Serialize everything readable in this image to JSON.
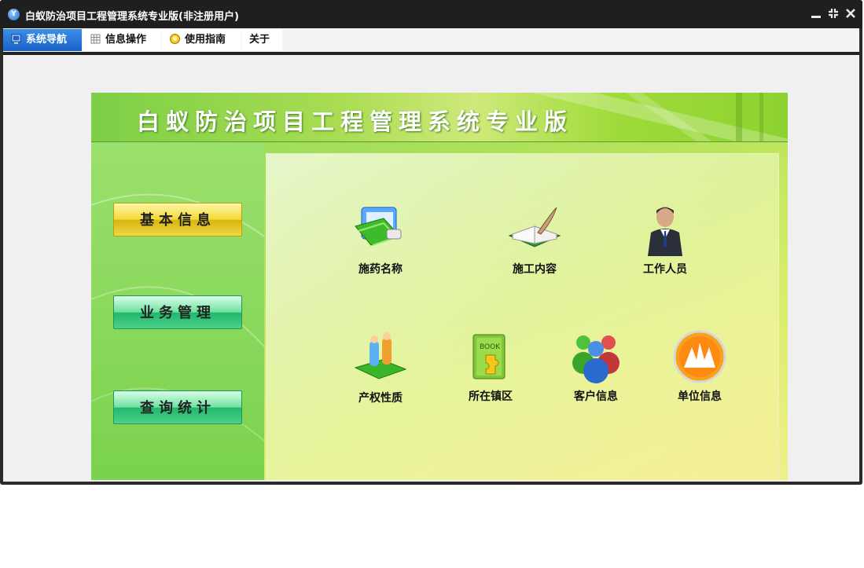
{
  "window": {
    "title": "白蚁防治项目工程管理系统专业版(非注册用户)"
  },
  "menu": {
    "tabs": [
      {
        "label": "系统导航"
      },
      {
        "label": "信息操作"
      },
      {
        "label": "使用指南"
      },
      {
        "label": "关于"
      }
    ]
  },
  "banner": {
    "title": "白蚁防治项目工程管理系统专业版"
  },
  "sidebar": {
    "buttons": [
      {
        "label": "基本信息"
      },
      {
        "label": "业务管理"
      },
      {
        "label": "查询统计"
      }
    ]
  },
  "modules": [
    {
      "label": "施药名称",
      "icon": "folder-doc-icon"
    },
    {
      "label": "施工内容",
      "icon": "book-quill-icon"
    },
    {
      "label": "工作人员",
      "icon": "businessman-icon"
    },
    {
      "label": "产权性质",
      "icon": "people-book-icon"
    },
    {
      "label": "所在镇区",
      "icon": "book-puzzle-icon"
    },
    {
      "label": "客户信息",
      "icon": "user-group-icon"
    },
    {
      "label": "单位信息",
      "icon": "orange-badge-icon"
    }
  ],
  "colors": {
    "accent": "#1a62c8",
    "panel_green": "#8cd85a",
    "titlebar": "#1f1f1f"
  }
}
